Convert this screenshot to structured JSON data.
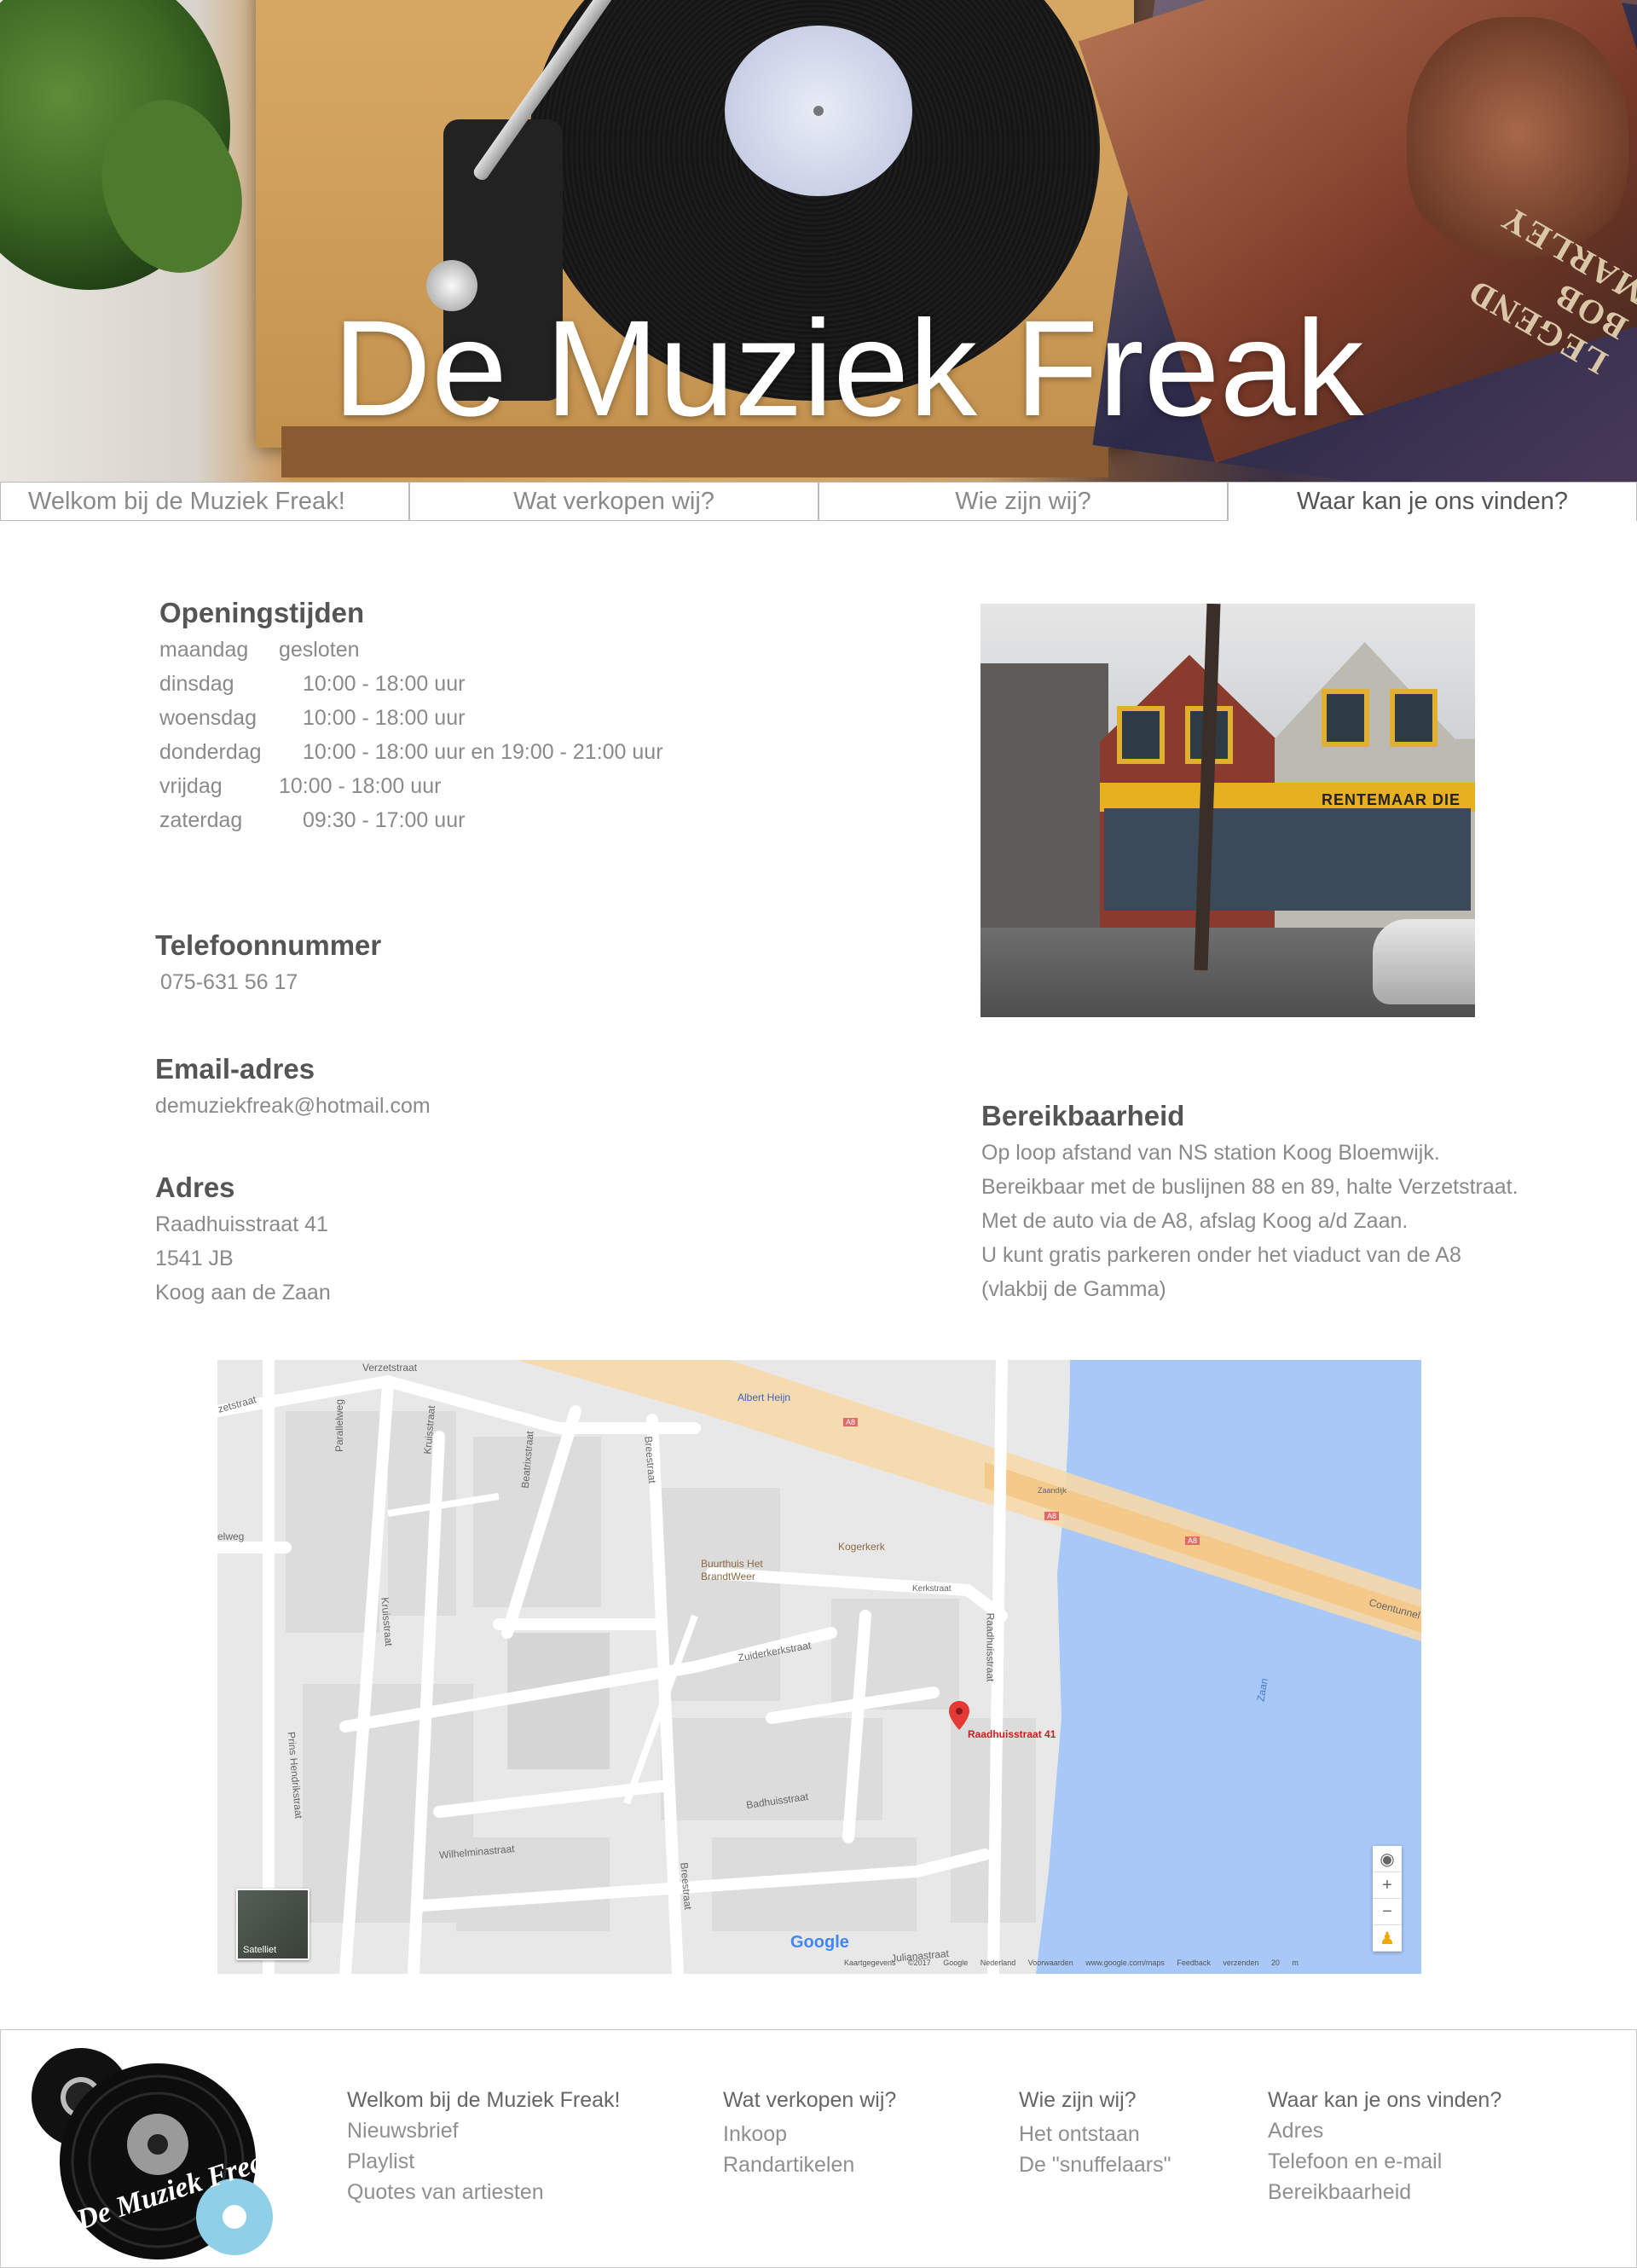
{
  "hero": {
    "title": "De Muziek Freak",
    "album_text": "LEGEND BOB MARLEY"
  },
  "nav": {
    "tabs": [
      {
        "label": "Welkom bij de Muziek Freak!"
      },
      {
        "label": "Wat verkopen wij?"
      },
      {
        "label": "Wie zijn wij?"
      },
      {
        "label": "Waar kan je ons vinden?"
      }
    ],
    "active_index": 3
  },
  "hours": {
    "heading": "Openingstijden",
    "rows": [
      {
        "day": "maandag",
        "time": "gesloten"
      },
      {
        "day": "dinsdag",
        "time": "10:00 - 18:00 uur"
      },
      {
        "day": "woensdag",
        "time": "10:00 - 18:00 uur"
      },
      {
        "day": "donderdag",
        "time": "10:00 - 18:00 uur en 19:00 - 21:00 uur"
      },
      {
        "day": "vrijdag",
        "time": "10:00 - 18:00 uur"
      },
      {
        "day": "zaterdag",
        "time": "09:30 - 17:00 uur"
      }
    ]
  },
  "phone": {
    "heading": "Telefoonnummer",
    "value": "075-631 56 17"
  },
  "email": {
    "heading": "Email-adres",
    "value": "demuziekfreak@hotmail.com"
  },
  "address": {
    "heading": "Adres",
    "line1": "Raadhuisstraat 41",
    "line2": "1541 JB",
    "line3": "Koog aan de Zaan"
  },
  "storefront": {
    "sign": "RENTEMAAR  DIE"
  },
  "reach": {
    "heading": "Bereikbaarheid",
    "line1": "Op loop afstand van NS station Koog Bloemwijk.",
    "line2": "Bereikbaar met de buslijnen 88 en 89, halte Verzetstraat.",
    "line3": "Met de auto via de A8, afslag Koog a/d Zaan.",
    "line4": "U kunt gratis parkeren onder het viaduct van de A8",
    "line5": "(vlakbij de Gamma)"
  },
  "map": {
    "labels": {
      "verzetstraat": "Verzetstraat",
      "verzetstraat2": "zetstraat",
      "parallelweg": "Parallelweg",
      "kruisstraat1": "Kruisstraat",
      "beatrixstraat": "Beatrixstraat",
      "breestraat1": "Breestraat",
      "albertheijn": "Albert Heijn",
      "zaandijk": "Zaandijk",
      "elweg": "elweg",
      "kogerkerk": "Kogerkerk",
      "buurthuis": "Buurthuis Het",
      "brandtweer": "BrandtWeer",
      "kerkstraat": "Kerkstraat",
      "kruisstraat2": "Kruisstraat",
      "zuiderkerkstraat": "Zuiderkerkstraat",
      "raadhuisstraat": "Raadhuisstraat",
      "zaan": "Zaan",
      "coentunnel": "Coentunnel",
      "princehendrik": "Prins Hendrikstraat",
      "badhuisstraat": "Badhuisstraat",
      "wilhelminastraat": "Wilhelminastraat",
      "breestraat2": "Breestraat",
      "julianastraat": "Julianastraat",
      "a8a": "A8",
      "a8b": "A8",
      "a8c": "A8"
    },
    "pin_label": "Raadhuisstraat 41",
    "satellite": "Satelliet",
    "google": "Google",
    "footnote": "Kaartgegevens ©2017 Google   Nederland   Voorwaarden   www.google.com/maps   Feedback verzenden   20 m",
    "zoom_in": "+",
    "zoom_out": "−"
  },
  "footer": {
    "logo_text": "De Muziek Freak",
    "col1": {
      "heading": "Welkom bij de Muziek Freak!",
      "links": [
        "Nieuwsbrief",
        "Playlist",
        "Quotes van artiesten"
      ]
    },
    "col2": {
      "heading": "Wat verkopen wij?",
      "links": [
        "Inkoop",
        "Randartikelen"
      ]
    },
    "col3": {
      "heading": "Wie zijn wij?",
      "links": [
        "Het ontstaan",
        "De \"snuffelaars\""
      ]
    },
    "col4": {
      "heading": "Waar kan je ons vinden?",
      "links": [
        "Adres",
        "Telefoon en e-mail",
        "Bereikbaarheid"
      ]
    }
  }
}
